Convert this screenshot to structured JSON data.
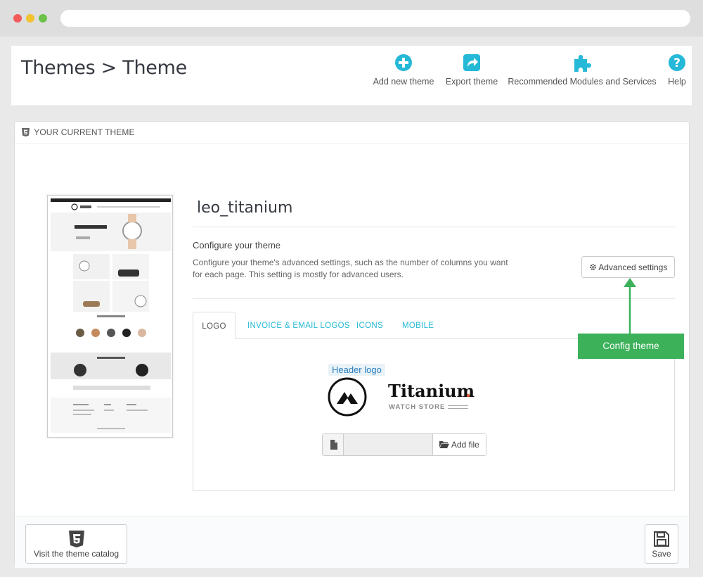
{
  "header": {
    "breadcrumb": "Themes > Theme",
    "toolbar": {
      "add_new_theme": "Add new theme",
      "export_theme": "Export theme",
      "recommended_modules": "Recommended Modules and Services",
      "help": "Help"
    }
  },
  "panel": {
    "heading": "YOUR CURRENT THEME",
    "theme_name": "leo_titanium",
    "configure_title": "Configure your theme",
    "configure_desc": "Configure your theme's advanced settings, such as the number of columns you want for each page. This setting is mostly for advanced users.",
    "advanced_settings_label": "Advanced settings",
    "tabs": [
      {
        "label": "LOGO",
        "active": true
      },
      {
        "label": "INVOICE & EMAIL LOGOS",
        "active": false
      },
      {
        "label": "ICONS",
        "active": false
      },
      {
        "label": "MOBILE",
        "active": false
      }
    ],
    "header_logo_label": "Header logo",
    "logo": {
      "brand": "Titanium",
      "dot": ".",
      "tagline": "WATCH STORE"
    },
    "add_file_label": "Add file",
    "callout": "Config theme",
    "footer": {
      "catalog_label": "Visit the theme catalog",
      "save_label": "Save"
    }
  },
  "colors": {
    "accent": "#25b9d7",
    "callout": "#3cb15a",
    "title": "#363a41"
  },
  "icons": [
    "plus-circle-icon",
    "share-icon",
    "puzzle-icon",
    "question-icon",
    "html5-icon",
    "cog-icon",
    "file-icon",
    "folder-open-icon",
    "floppy-icon"
  ]
}
